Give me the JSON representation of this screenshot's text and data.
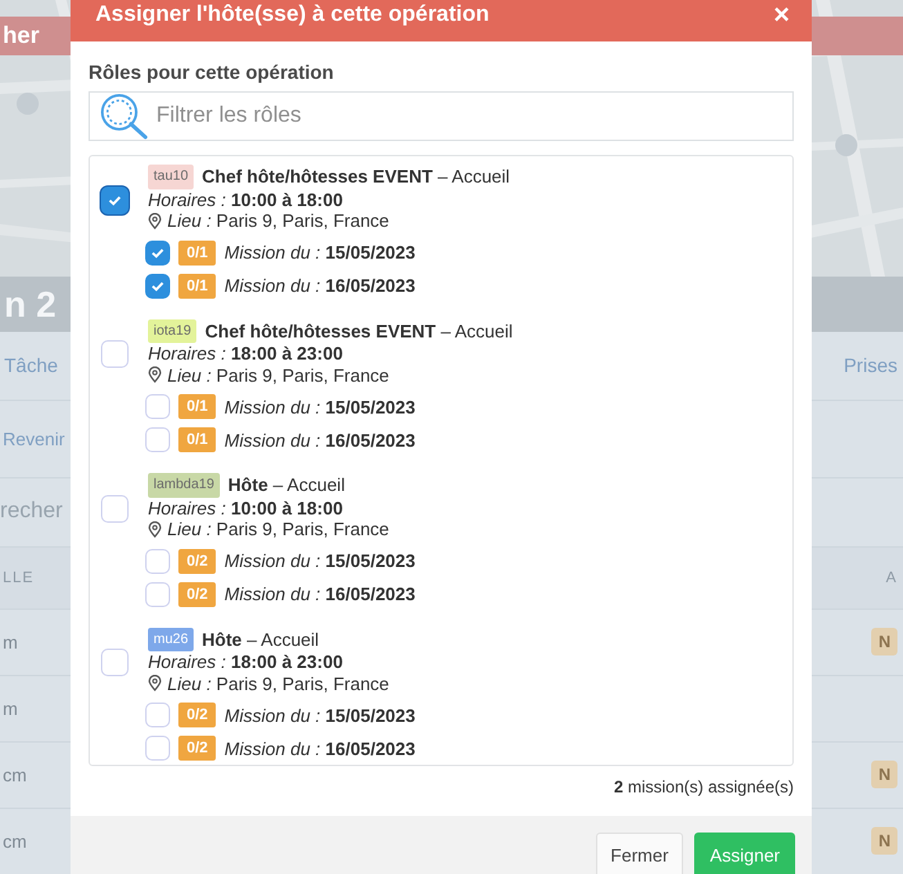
{
  "background": {
    "banner": "her",
    "heading": "n 2",
    "tabs": [
      {
        "label": "Tâche"
      },
      {
        "label": "Prises"
      }
    ],
    "link": "Revenir",
    "search": {
      "placeholder": "recher"
    },
    "table": {
      "columns": [
        "LLE",
        "A"
      ],
      "rows": [
        {
          "column_1": "m",
          "badge": "N"
        },
        {
          "column_1": "m"
        },
        {
          "column_1": "cm",
          "badge": "N"
        },
        {
          "column_1": "cm",
          "badge": "N"
        }
      ]
    }
  },
  "modal": {
    "title": "Assigner l'hôte(sse) à cette opération",
    "close": "×",
    "section_label": "Rôles pour cette opération",
    "search": {
      "placeholder": "Filtrer les rôles"
    },
    "roles": [
      {
        "tag": "tau10",
        "color": "#f6d6d3",
        "title": "**Chef hôte/hôtesses EVENT** – Accueil",
        "hours": "*Horaires :* **10:00 à 18:00**",
        "place": "*Lieu :* Paris 9, Paris, France",
        "checked": true,
        "missions": [
          {
            "count": "0/1",
            "text": "*Mission du :* **15/05/2023**",
            "checked": true
          },
          {
            "count": "0/1",
            "text": "*Mission du :* **16/05/2023**",
            "checked": true
          }
        ]
      },
      {
        "tag": "iota19",
        "color": "#e3f39a",
        "title": "**Chef hôte/hôtesses EVENT** – Accueil",
        "hours": "*Horaires :* **18:00 à 23:00**",
        "place": "*Lieu :* Paris 9, Paris, France",
        "checked": false,
        "missions": [
          {
            "count": "0/1",
            "text": "*Mission du :* **15/05/2023**",
            "checked": false
          },
          {
            "count": "0/1",
            "text": "*Mission du :* **16/05/2023**",
            "checked": false
          }
        ]
      },
      {
        "tag": "lambda19",
        "color": "#c8d8a6",
        "title": "**Hôte** – Accueil",
        "hours": "*Horaires :* **10:00 à 18:00**",
        "place": "*Lieu :* Paris 9, Paris, France",
        "checked": false,
        "missions": [
          {
            "count": "0/2",
            "text": "*Mission du :* **15/05/2023**",
            "checked": false
          },
          {
            "count": "0/2",
            "text": "*Mission du :* **16/05/2023**",
            "checked": false
          }
        ]
      },
      {
        "tag": "mu26",
        "color": "#7ea8ea",
        "title": "**Hôte** – Accueil",
        "hours": "*Horaires :* **18:00 à 23:00**",
        "place": "*Lieu :* Paris 9, Paris, France",
        "checked": false,
        "missions": [
          {
            "count": "0/2",
            "text": "*Mission du :* **15/05/2023**",
            "checked": false
          },
          {
            "count": "0/2",
            "text": "*Mission du :* **16/05/2023**",
            "checked": false
          }
        ]
      }
    ],
    "summary": "**2** mission(s) assignée(s)",
    "buttons": [
      {
        "label": "Fermer",
        "kind": "secondary"
      },
      {
        "label": "Assigner",
        "kind": "primary"
      }
    ]
  }
}
